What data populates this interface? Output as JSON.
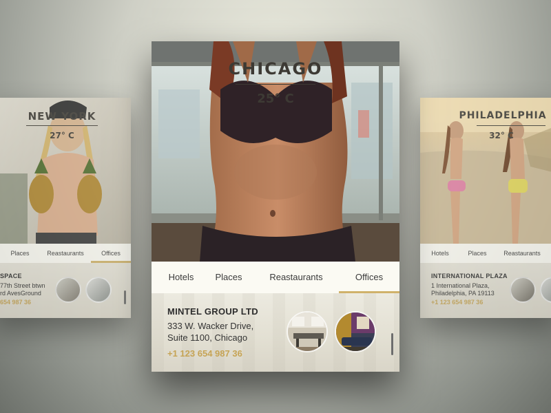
{
  "cards": {
    "left": {
      "city": "NEW YORK",
      "temperature": "27° C",
      "tabs": [
        "Places",
        "Reastaurants",
        "Offices"
      ],
      "business": {
        "name": "SPACE",
        "address_line1": "77th Street btwn",
        "address_line2": "rd AvesGround",
        "phone": "654 987 36"
      }
    },
    "center": {
      "city": "CHICAGO",
      "temperature": "25° C",
      "tabs": [
        "Hotels",
        "Places",
        "Reastaurants",
        "Offices"
      ],
      "active_tab": "Offices",
      "business": {
        "name": "MINTEL GROUP LTD",
        "address_line1": "333 W. Wacker Drive,",
        "address_line2": "Suite 1100, Chicago",
        "phone": "+1 123 654 987 36"
      }
    },
    "right": {
      "city": "PHILADELPHIA",
      "temperature": "32° C",
      "tabs": [
        "Hotels",
        "Places",
        "Reastaurants"
      ],
      "business": {
        "name": "INTERNATIONAL PLAZA",
        "address_line1": "1 International Plaza,",
        "address_line2": "Philadelphia, PA 19113",
        "phone": "+1 123 654 987 36"
      }
    }
  },
  "colors": {
    "accent_gold": "#c6a455",
    "tab_underline": "#d0b26a",
    "card_background": "#fbfaf3"
  }
}
